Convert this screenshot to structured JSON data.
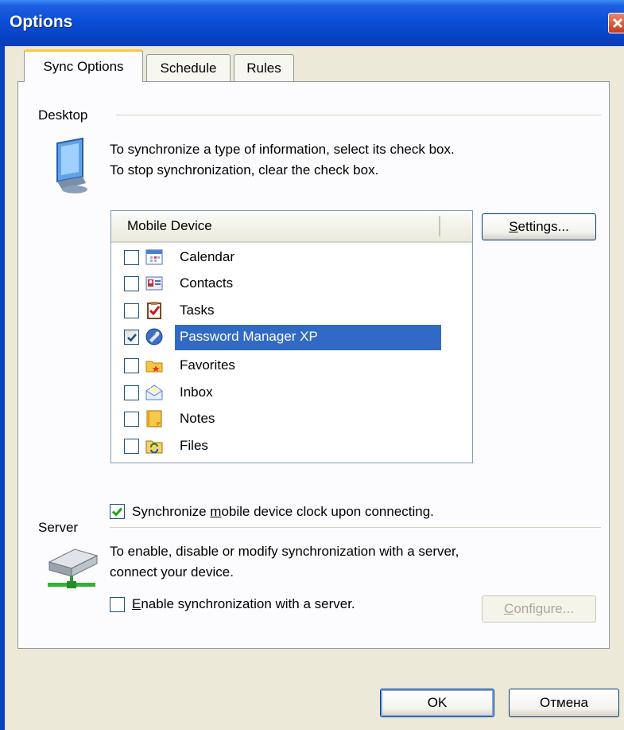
{
  "window": {
    "title": "Options"
  },
  "tabs": [
    {
      "label": "Sync Options",
      "active": true
    },
    {
      "label": "Schedule",
      "active": false
    },
    {
      "label": "Rules",
      "active": false
    }
  ],
  "desktop": {
    "group_label": "Desktop",
    "instructions_line1": "To synchronize a type of information, select its check box.",
    "instructions_line2": "To stop synchronization, clear the check box.",
    "list_header": "Mobile Device",
    "settings_button": {
      "pre": "",
      "accel": "S",
      "post": "ettings..."
    },
    "items": [
      {
        "label": "Calendar",
        "icon": "calendar-icon",
        "checked": false
      },
      {
        "label": "Contacts",
        "icon": "contacts-icon",
        "checked": false
      },
      {
        "label": "Tasks",
        "icon": "tasks-icon",
        "checked": false
      },
      {
        "label": "Password Manager XP",
        "icon": "password-manager-icon",
        "checked": true,
        "selected": true
      },
      {
        "label": "Favorites",
        "icon": "favorites-icon",
        "checked": false
      },
      {
        "label": "Inbox",
        "icon": "inbox-icon",
        "checked": false
      },
      {
        "label": "Notes",
        "icon": "notes-icon",
        "checked": false
      },
      {
        "label": "Files",
        "icon": "files-icon",
        "checked": false
      }
    ],
    "clock_sync": {
      "checked": true,
      "pre": "Synchronize ",
      "accel": "m",
      "post": "obile device clock upon connecting."
    }
  },
  "server": {
    "group_label": "Server",
    "instructions_line1": "To enable, disable or modify synchronization with a server,",
    "instructions_line2": "connect your device.",
    "enable": {
      "checked": false,
      "pre": "",
      "accel": "E",
      "post": "nable synchronization with a server."
    },
    "configure_button": {
      "pre": "",
      "accel": "C",
      "post": "onfigure...",
      "disabled": true
    }
  },
  "footer": {
    "ok_label": "OK",
    "cancel_label": "Отмена"
  },
  "colors": {
    "titlebar": "#0a4ed8",
    "selection": "#316ac5",
    "face": "#ece9d8",
    "check": "#21a121"
  }
}
